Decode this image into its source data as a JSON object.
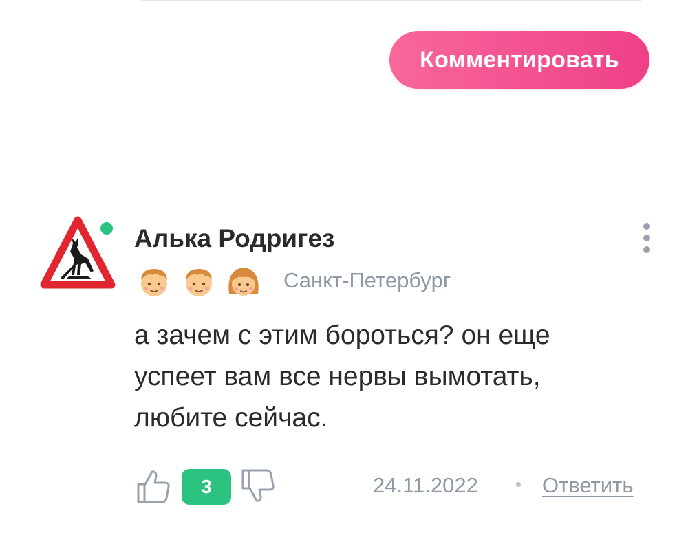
{
  "composer": {
    "submit_label": "Комментировать"
  },
  "comment": {
    "author": "Алька Родригез",
    "online": true,
    "avatar_icon": "deer-warning-sign-icon",
    "badges": [
      {
        "icon": "boy-face-icon"
      },
      {
        "icon": "boy-face-icon"
      },
      {
        "icon": "girl-face-icon"
      }
    ],
    "city": "Санкт-Петербург",
    "text": "а зачем с этим бороться? он еще успеет вам все нервы вымотать, любите сейчас.",
    "rating": "3",
    "date": "24.11.2022",
    "reply_label": "Ответить"
  },
  "colors": {
    "accent_pink": "#ef3f87",
    "online_green": "#2bc37f",
    "muted_gray": "#8e98a6"
  }
}
